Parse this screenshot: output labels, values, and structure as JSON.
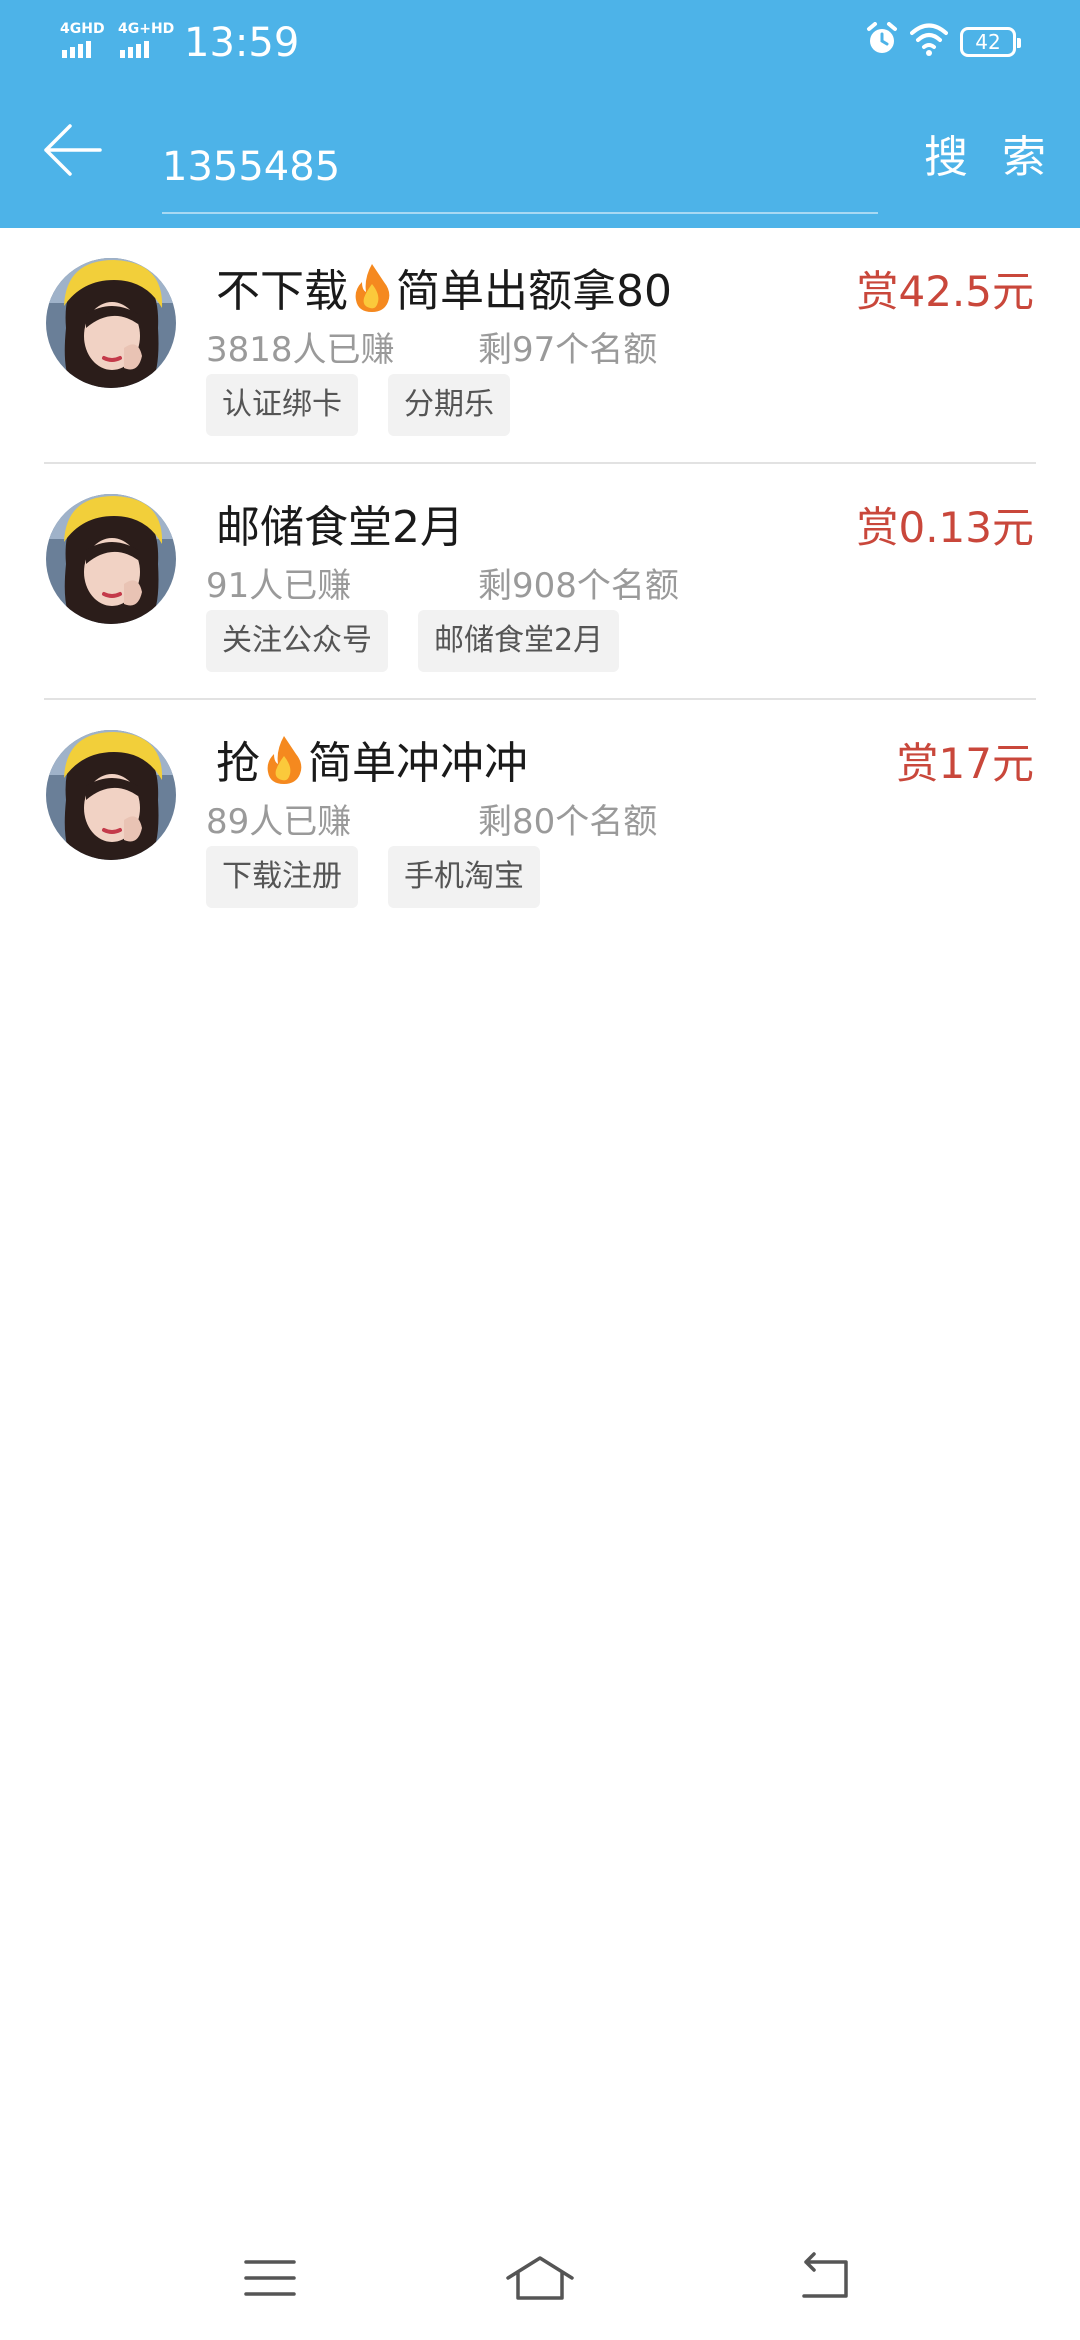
{
  "statusbar": {
    "network1": "4GHD",
    "network2": "4G+HD",
    "time": "13:59",
    "battery": "42",
    "icons": [
      "alarm-icon",
      "wifi-icon",
      "battery-icon"
    ]
  },
  "header": {
    "back_icon": "arrow-left-icon",
    "search_value": "1355485",
    "search_label": "搜 索",
    "background": "#4db3e8"
  },
  "tasks": [
    {
      "title_before": "不下载",
      "title_after": "简单出额拿80",
      "has_fire": true,
      "reward": "赏42.5元",
      "earned": "3818人已赚",
      "remaining": "剩97个名额",
      "tags": [
        "认证绑卡",
        "分期乐"
      ]
    },
    {
      "title_before": "邮储食堂2月",
      "title_after": "",
      "has_fire": false,
      "reward": "赏0.13元",
      "earned": "91人已赚",
      "remaining": "剩908个名额",
      "tags": [
        "关注公众号",
        "邮储食堂2月"
      ]
    },
    {
      "title_before": "抢",
      "title_after": "简单冲冲冲",
      "has_fire": true,
      "reward": "赏17元",
      "earned": "89人已赚",
      "remaining": "剩80个名额",
      "tags": [
        "下载注册",
        "手机淘宝"
      ]
    }
  ],
  "colors": {
    "reward": "#c9473b",
    "meta": "#9a9a9a"
  },
  "navbar": {
    "icons": [
      "menu-icon",
      "home-icon",
      "back-icon"
    ]
  }
}
